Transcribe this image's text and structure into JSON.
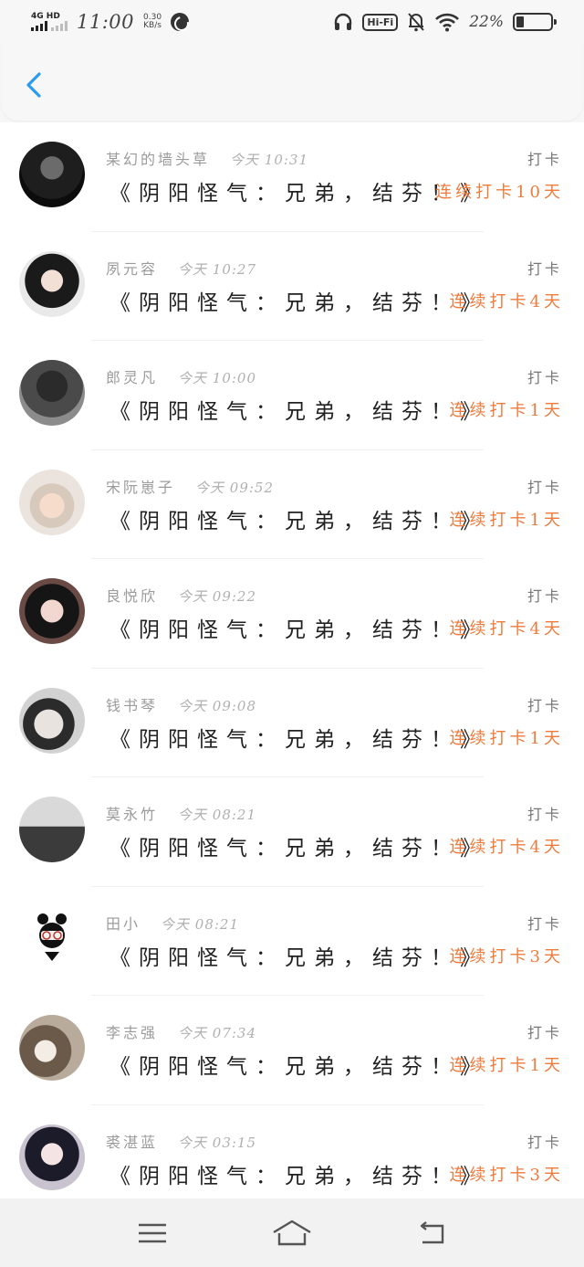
{
  "status_bar": {
    "network": "4G HD",
    "time": "11:00",
    "speed_value": "0.30",
    "speed_unit": "KB/s",
    "hifi": "Hi-Fi",
    "battery_pct": "22%"
  },
  "header": {
    "back_icon": "chevron-left-icon"
  },
  "items": [
    {
      "name": "某幻的墙头草",
      "time": "今天 10:31",
      "title": "《阴阳怪气：兄弟，结芬！》",
      "tag": "打卡",
      "streak": "连续打卡10天"
    },
    {
      "name": "夙元容",
      "time": "今天 10:27",
      "title": "《阴阳怪气：兄弟，结芬！》",
      "tag": "打卡",
      "streak": "连续打卡4天"
    },
    {
      "name": "郎灵凡",
      "time": "今天 10:00",
      "title": "《阴阳怪气：兄弟，结芬！》",
      "tag": "打卡",
      "streak": "连续打卡1天"
    },
    {
      "name": "宋阮崽子",
      "time": "今天 09:52",
      "title": "《阴阳怪气：兄弟，结芬！》",
      "tag": "打卡",
      "streak": "连续打卡1天"
    },
    {
      "name": "良悦欣",
      "time": "今天 09:22",
      "title": "《阴阳怪气：兄弟，结芬！》",
      "tag": "打卡",
      "streak": "连续打卡4天"
    },
    {
      "name": "钱书琴",
      "time": "今天 09:08",
      "title": "《阴阳怪气：兄弟，结芬！》",
      "tag": "打卡",
      "streak": "连续打卡1天"
    },
    {
      "name": "莫永竹",
      "time": "今天 08:21",
      "title": "《阴阳怪气：兄弟，结芬！》",
      "tag": "打卡",
      "streak": "连续打卡4天"
    },
    {
      "name": "田小",
      "time": "今天 08:21",
      "title": "《阴阳怪气：兄弟，结芬！》",
      "tag": "打卡",
      "streak": "连续打卡3天"
    },
    {
      "name": "李志强",
      "time": "今天 07:34",
      "title": "《阴阳怪气：兄弟，结芬！》",
      "tag": "打卡",
      "streak": "连续打卡1天"
    },
    {
      "name": "裘湛蓝",
      "time": "今天 03:15",
      "title": "《阴阳怪气：兄弟，结芬！》",
      "tag": "打卡",
      "streak": "连续打卡3天"
    }
  ],
  "colors": {
    "accent_back": "#2a9cf0",
    "streak": "#ee7b3c"
  },
  "navbar": {
    "icons": [
      "menu-icon",
      "home-icon",
      "back-icon"
    ]
  }
}
